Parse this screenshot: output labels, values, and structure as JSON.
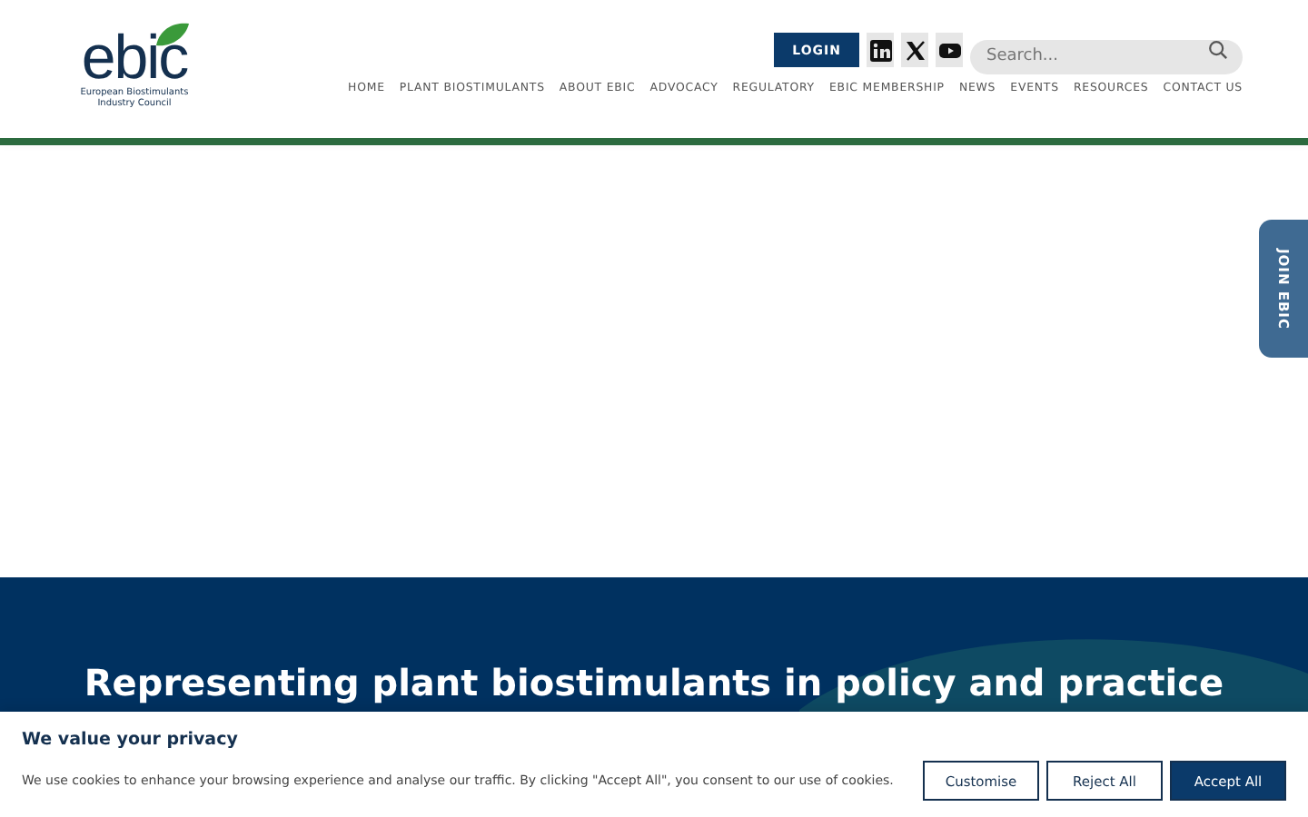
{
  "logo": {
    "wordmark": "ebic",
    "tagline": "European Biostimulants Industry Council"
  },
  "header": {
    "login": "LOGIN",
    "search": {
      "placeholder": "Search..."
    }
  },
  "nav": [
    "HOME",
    "PLANT BIOSTIMULANTS",
    "ABOUT EBIC",
    "ADVOCACY",
    "REGULATORY",
    "EBIC MEMBERSHIP",
    "NEWS",
    "EVENTS",
    "RESOURCES",
    "CONTACT US"
  ],
  "side_tab": "JOIN EBIC",
  "hero": {
    "title": "Representing plant biostimulants in policy and practice"
  },
  "cookie_banner": {
    "title": "We value your privacy",
    "text": "We use cookies to enhance your browsing experience and analyse our traffic. By clicking \"Accept All\", you consent to our use of cookies.",
    "buttons": [
      {
        "label": "Customise",
        "kind": "outline"
      },
      {
        "label": "Reject All",
        "kind": "outline"
      },
      {
        "label": "Accept All",
        "kind": "primary"
      }
    ]
  }
}
